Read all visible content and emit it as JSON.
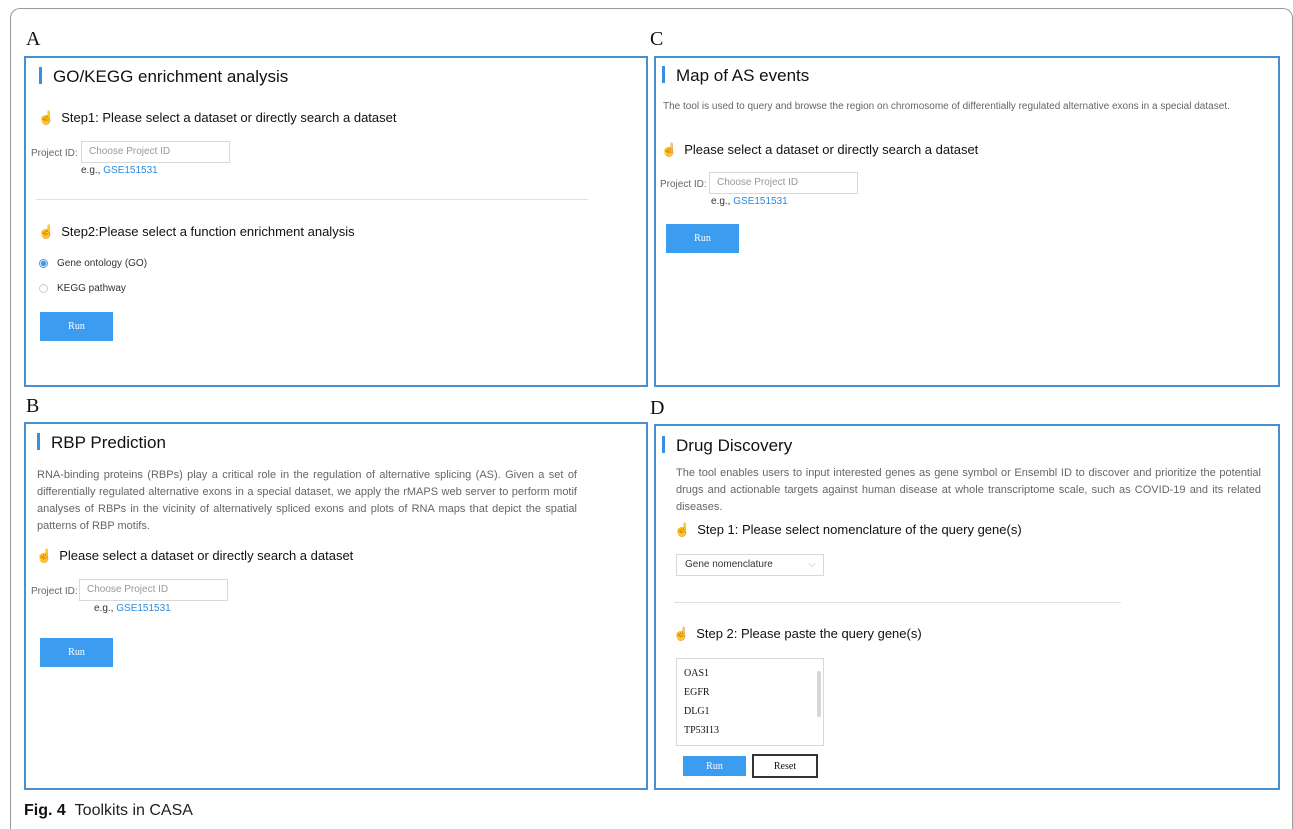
{
  "panels": {
    "a": {
      "letter": "A",
      "title": "GO/KEGG enrichment analysis",
      "step1": "Step1: Please select a dataset or directly search a dataset",
      "project_label": "Project ID:",
      "project_placeholder": "Choose Project ID",
      "eg_prefix": "e.g.,",
      "eg_link": "GSE151531",
      "step2": "Step2:Please select a function enrichment analysis",
      "options": [
        {
          "label": "Gene ontology (GO)",
          "selected": true
        },
        {
          "label": "KEGG pathway",
          "selected": false
        }
      ],
      "run": "Run"
    },
    "b": {
      "letter": "B",
      "title": "RBP Prediction",
      "description": "RNA-binding proteins (RBPs) play a critical role in the regulation of alternative splicing (AS). Given a set of differentially regulated alternative exons in a special dataset, we apply the rMAPS web server to perform motif analyses of RBPs in the vicinity of alternatively spliced exons and plots of RNA maps that depict the spatial patterns of RBP motifs.",
      "step": "Please select a dataset or directly search a dataset",
      "project_label": "Project ID:",
      "project_placeholder": "Choose Project ID",
      "eg_prefix": "e.g.,",
      "eg_link": "GSE151531",
      "run": "Run"
    },
    "c": {
      "letter": "C",
      "title": "Map of AS events",
      "description": "The tool is used to query and browse the region on chromosome of differentially regulated alternative exons in a special dataset.",
      "step": "Please select a dataset or directly search a dataset",
      "project_label": "Project ID:",
      "project_placeholder": "Choose Project ID",
      "eg_prefix": "e.g.,",
      "eg_link": "GSE151531",
      "run": "Run"
    },
    "d": {
      "letter": "D",
      "title": "Drug Discovery",
      "description": "The tool enables users to input interested genes as gene symbol or Ensembl ID to discover and prioritize the potential drugs and actionable targets against human disease at whole transcriptome scale, such as COVID-19 and its related diseases.",
      "step1": "Step 1: Please select nomenclature of the query gene(s)",
      "select_value": "Gene nomenclature",
      "step2": "Step 2: Please paste the query gene(s)",
      "genes": [
        "OAS1",
        "EGFR",
        "DLG1",
        "TP53I13"
      ],
      "run": "Run",
      "reset": "Reset"
    }
  },
  "caption": {
    "label": "Fig. 4",
    "text": "Toolkits in CASA"
  },
  "colors": {
    "accent": "#3b9cf0",
    "panel_border": "#4a90d0",
    "link": "#2a8ae0"
  }
}
